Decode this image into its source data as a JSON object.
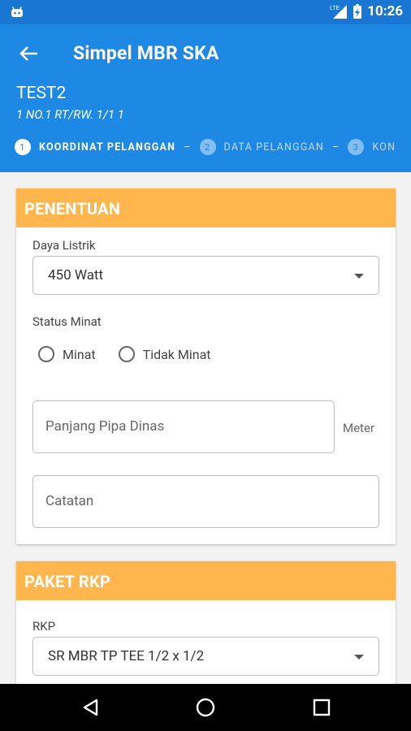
{
  "status_bar": {
    "time": "10:26",
    "network": "LTE",
    "left_icon": "android-notification-icon"
  },
  "app_bar": {
    "title": "Simpel MBR SKA",
    "customer_name": "TEST2",
    "customer_address": "1 NO.1 RT/RW. 1/1 1"
  },
  "stepper": {
    "steps": [
      {
        "number": "1",
        "label": "KOORDINAT PELANGGAN"
      },
      {
        "number": "2",
        "label": "DATA PELANGGAN"
      },
      {
        "number": "3",
        "label": "KON"
      }
    ],
    "separator": "–"
  },
  "penentuan": {
    "header": "PENENTUAN",
    "daya_label": "Daya Listrik",
    "daya_value": "450 Watt",
    "status_label": "Status Minat",
    "options": [
      "Minat",
      "Tidak Minat"
    ],
    "pipa_placeholder": "Panjang Pipa Dinas",
    "pipa_unit": "Meter",
    "catatan_placeholder": "Catatan"
  },
  "paket_rkp": {
    "header": "PAKET RKP",
    "rkp_label": "RKP",
    "rkp_value": "SR MBR TP TEE 1/2 x 1/2"
  },
  "colors": {
    "appbar": "#1e88e5",
    "statusbar": "#1976d2",
    "section_header": "#ffb74d"
  }
}
